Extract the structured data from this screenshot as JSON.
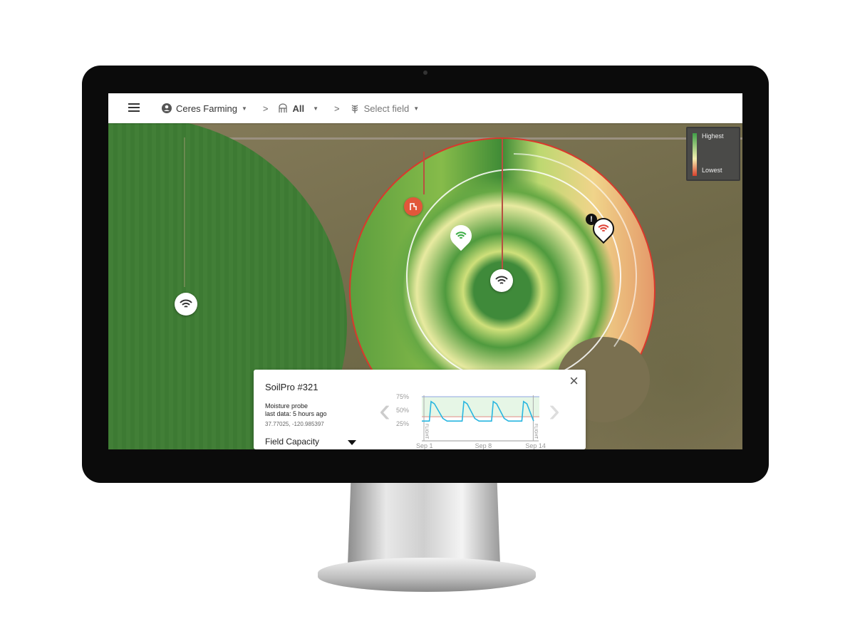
{
  "header": {
    "org": "Ceres Farming",
    "farm": "All",
    "field_placeholder": "Select field",
    "separator": ">"
  },
  "legend": {
    "high": "Highest",
    "low": "Lowest"
  },
  "popup": {
    "title": "SoilPro #321",
    "type": "Moisture probe",
    "last_data": "last data: 5 hours ago",
    "coords": "37.77025, -120.985397",
    "metric": "Field Capacity",
    "close": "×",
    "prev": "‹",
    "next": "›"
  },
  "colors": {
    "sensor_ok": "#3fae49",
    "sensor_alert": "#e0453a",
    "chart_line": "#29b6e0",
    "upper_threshold": "#8fa6e0",
    "lower_threshold": "#e08a80",
    "band": "#e6f6e6"
  },
  "chart_data": {
    "type": "line",
    "yticks": [
      "75%",
      "50%",
      "25%"
    ],
    "ylim": [
      25,
      75
    ],
    "xticks": [
      "Sep 1",
      "Sep 8",
      "Sep 14"
    ],
    "annotations": [
      "FLIGHT",
      "FLIGHT"
    ],
    "thresholds": {
      "upper": 75,
      "lower": 38
    },
    "series": [
      {
        "x": [
          0,
          0.9,
          1.1,
          1.5,
          2.5,
          3,
          4.8,
          5,
          5.4,
          6.3,
          6.8,
          8.3,
          8.5,
          8.9,
          9.8,
          10.3,
          11.9,
          12.1,
          12.5,
          13.3
        ],
        "values": [
          30,
          30,
          66,
          62,
          35,
          30,
          30,
          66,
          62,
          35,
          30,
          30,
          66,
          62,
          35,
          30,
          30,
          66,
          62,
          30
        ]
      }
    ]
  }
}
